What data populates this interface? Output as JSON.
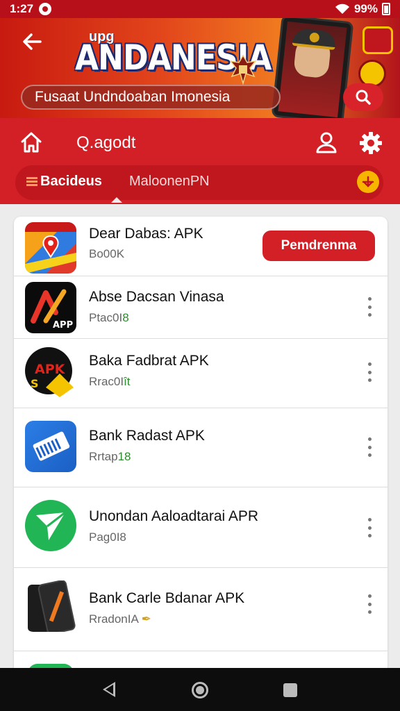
{
  "status_bar": {
    "time": "1:27",
    "battery": "99%"
  },
  "banner": {
    "brand_small": "upg",
    "brand": "ANDANESIA",
    "search_placeholder": "Fusaat Undndoaban Imonesia"
  },
  "app_bar": {
    "title": "Q.agodt"
  },
  "tabs": [
    {
      "label": "Bacideus",
      "active": true
    },
    {
      "label": "MaloonenPN",
      "active": false
    }
  ],
  "apps": [
    {
      "name": "Dear Dabas: APK",
      "sub": "Bo00K",
      "sub_extra": "",
      "action": "Pemdrenma",
      "icon": "map-app-icon"
    },
    {
      "name": "Abse Dacsan Vinasa",
      "sub": "Ptac0I",
      "sub_extra": "8",
      "action": "",
      "icon": "app-logo-icon"
    },
    {
      "name": "Baka Fadbrat APK",
      "sub": "Rrac0I",
      "sub_extra": "ît",
      "action": "",
      "icon": "apk-badge-icon"
    },
    {
      "name": "Bank Radast APK",
      "sub": "Rrtap",
      "sub_extra": "18",
      "action": "",
      "icon": "bank-card-icon"
    },
    {
      "name": "Unondan Aaloadtarai APR",
      "sub": "Pag0I8",
      "sub_extra": "",
      "action": "",
      "icon": "send-plane-icon"
    },
    {
      "name": "Bank Carle Bdanar APK",
      "sub": "RradonIA",
      "sub_extra": "",
      "action": "",
      "icon": "phone-app-icon"
    }
  ],
  "colors": {
    "primary": "#d31f26",
    "banner_orange": "#f07a20",
    "nav": "#0d0d0d"
  }
}
